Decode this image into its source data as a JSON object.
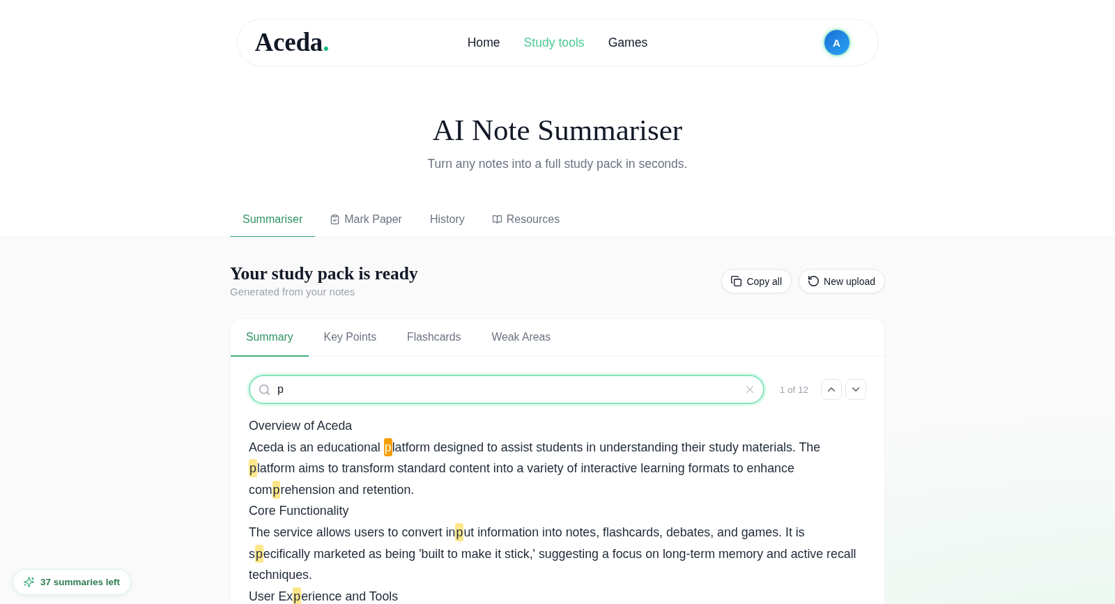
{
  "header": {
    "logo": {
      "name": "Aceda",
      "dot": "."
    },
    "nav": [
      {
        "label": "Home",
        "selected": false
      },
      {
        "label": "Study tools",
        "selected": true
      },
      {
        "label": "Games",
        "selected": false
      }
    ],
    "avatar": {
      "initial": "A"
    }
  },
  "hero": {
    "title": "AI Note Summariser",
    "subtitle": "Turn any notes into a full study pack in seconds."
  },
  "tabs": [
    {
      "label": "Summariser",
      "selected": true
    },
    {
      "label": "Mark Paper",
      "selected": false
    },
    {
      "label": "History",
      "selected": false
    },
    {
      "label": "Resources",
      "selected": false
    }
  ],
  "study_pack": {
    "title": "Your study pack is ready",
    "subtitle": "Generated from your notes",
    "buttons": [
      "Copy all",
      "New upload"
    ],
    "tabs": [
      {
        "label": "Summary",
        "selected": true
      },
      {
        "label": "Key Points",
        "selected": false
      },
      {
        "label": "Flashcards",
        "selected": false
      },
      {
        "label": "Weak Areas",
        "selected": false
      }
    ],
    "search": {
      "value": "p",
      "match_count": "1 of 12"
    },
    "content": [
      {
        "segments": [
          {
            "kind": "text",
            "text": "Overview of Aceda"
          }
        ]
      },
      {
        "segments": [
          {
            "kind": "text",
            "text": "Aceda is an educational "
          },
          {
            "kind": "current_match",
            "text": "p"
          },
          {
            "kind": "text",
            "text": "latform designed to assist students in understanding their study materials. The "
          },
          {
            "kind": "match",
            "text": "p"
          },
          {
            "kind": "text",
            "text": "latform aims to transform standard content into a variety of interactive learning formats to enhance com"
          },
          {
            "kind": "match",
            "text": "p"
          },
          {
            "kind": "text",
            "text": "rehension and retention."
          }
        ]
      },
      {
        "segments": [
          {
            "kind": "text",
            "text": "Core Functionality"
          }
        ]
      },
      {
        "segments": [
          {
            "kind": "text",
            "text": "The service allows users to convert in"
          },
          {
            "kind": "match",
            "text": "p"
          },
          {
            "kind": "text",
            "text": "ut information into notes, flashcards, debates, and games. It is s"
          },
          {
            "kind": "match",
            "text": "p"
          },
          {
            "kind": "text",
            "text": "ecifically marketed as being 'built to make it stick,' suggesting a focus on long-term memory and active recall techniques."
          }
        ]
      },
      {
        "segments": [
          {
            "kind": "text",
            "text": "User Ex"
          },
          {
            "kind": "match",
            "text": "p"
          },
          {
            "kind": "text",
            "text": "erience and Tools"
          }
        ]
      }
    ]
  },
  "quota_badge": {
    "label": "37 summaries left"
  }
}
